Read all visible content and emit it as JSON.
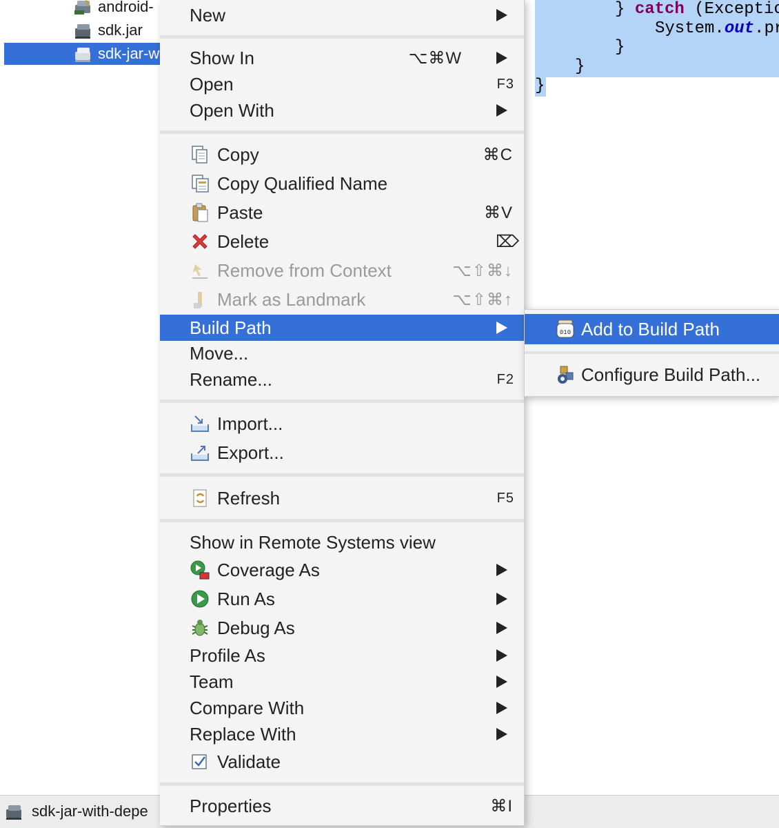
{
  "explorer": {
    "items": [
      {
        "label": "android-"
      },
      {
        "label": "sdk.jar"
      },
      {
        "label": "sdk-jar-w"
      }
    ]
  },
  "editor": {
    "line1_brace": "} ",
    "line1_kw": "catch",
    "line1_rest": " (Exceptio",
    "line2_a": "System.",
    "line2_field": "out",
    "line2_b": ".pr",
    "line3": "}",
    "line4": "}",
    "line5": "}"
  },
  "menu": {
    "new": {
      "label": "New"
    },
    "show_in": {
      "label": "Show In",
      "shortcut": "⌥⌘W"
    },
    "open": {
      "label": "Open",
      "shortcut": "F3"
    },
    "open_with": {
      "label": "Open With"
    },
    "copy": {
      "label": "Copy",
      "shortcut": "⌘C"
    },
    "copy_qualified": {
      "label": "Copy Qualified Name"
    },
    "paste": {
      "label": "Paste",
      "shortcut": "⌘V"
    },
    "delete": {
      "label": "Delete",
      "shortcut": "⌦"
    },
    "remove_context": {
      "label": "Remove from Context",
      "shortcut": "⌥⇧⌘↓"
    },
    "mark_landmark": {
      "label": "Mark as Landmark",
      "shortcut": "⌥⇧⌘↑"
    },
    "build_path": {
      "label": "Build Path"
    },
    "move": {
      "label": "Move..."
    },
    "rename": {
      "label": "Rename...",
      "shortcut": "F2"
    },
    "import": {
      "label": "Import..."
    },
    "export": {
      "label": "Export..."
    },
    "refresh": {
      "label": "Refresh",
      "shortcut": "F5"
    },
    "show_remote": {
      "label": "Show in Remote Systems view"
    },
    "coverage_as": {
      "label": "Coverage As"
    },
    "run_as": {
      "label": "Run As"
    },
    "debug_as": {
      "label": "Debug As"
    },
    "profile_as": {
      "label": "Profile As"
    },
    "team": {
      "label": "Team"
    },
    "compare_with": {
      "label": "Compare With"
    },
    "replace_with": {
      "label": "Replace With"
    },
    "validate": {
      "label": "Validate"
    },
    "properties": {
      "label": "Properties",
      "shortcut": "⌘I"
    }
  },
  "submenu": {
    "add_to_build_path": {
      "label": "Add to Build Path"
    },
    "configure_build_path": {
      "label": "Configure Build Path..."
    }
  },
  "statusbar": {
    "label": "sdk-jar-with-depe"
  },
  "colors": {
    "selection": "#3570d8",
    "code_selection": "#b3d3f7",
    "menu_bg": "#f4f4f4",
    "keyword": "#7f0055",
    "field": "#0000c0"
  }
}
